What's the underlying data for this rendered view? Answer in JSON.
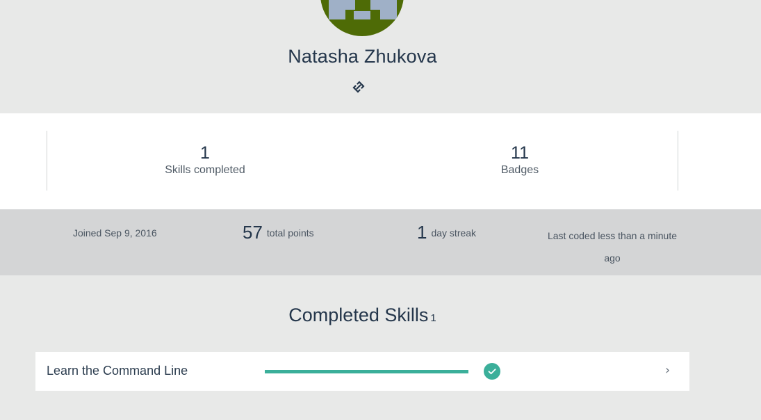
{
  "profile": {
    "name": "Natasha Zhukova",
    "avatar_icon": "pixel-avatar-icon",
    "link_icon": "link-icon"
  },
  "stats": {
    "skills_count": "1",
    "skills_label": "Skills completed",
    "badges_count": "11",
    "badges_label": "Badges"
  },
  "info": {
    "joined": "Joined Sep 9, 2016",
    "points_value": "57",
    "points_label": "total points",
    "streak_value": "1",
    "streak_label": "day streak",
    "last_coded": "Last coded less than a minute ago"
  },
  "completed": {
    "title": "Completed Skills",
    "count": "1",
    "skills": [
      {
        "name": "Learn the Command Line",
        "progress": 1.0,
        "status_icon": "checkmark-icon",
        "chevron": "›"
      }
    ]
  },
  "colors": {
    "accent": "#3baf9a",
    "avatar_bg": "#4e6b06",
    "avatar_fg": "#9fb0c7",
    "page_bg": "#e8e9e8",
    "info_bar_bg": "#d4d5d6"
  }
}
